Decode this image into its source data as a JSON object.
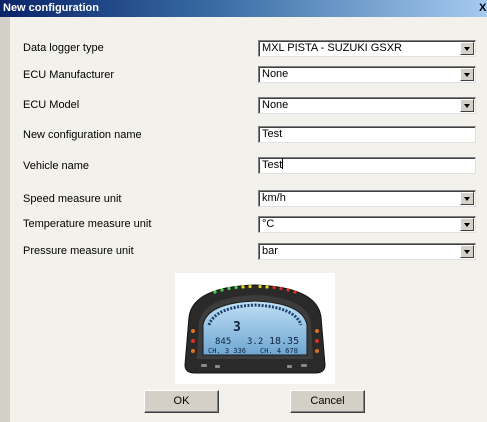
{
  "window": {
    "title": "New configuration",
    "close_label": "X"
  },
  "form": {
    "rows": [
      {
        "label": "Data logger type",
        "value": "MXL PISTA - SUZUKI GSXR",
        "control": "dropdown"
      },
      {
        "label": "ECU Manufacturer",
        "value": "None",
        "control": "dropdown"
      },
      {
        "label": "ECU Model",
        "value": "None",
        "control": "dropdown"
      },
      {
        "label": "New configuration name",
        "value": "Test",
        "control": "text"
      },
      {
        "label": "Vehicle name",
        "value": "Test",
        "control": "text"
      },
      {
        "label": "Speed measure unit",
        "value": "km/h",
        "control": "dropdown"
      },
      {
        "label": "Temperature measure unit",
        "value": "°C",
        "control": "dropdown"
      },
      {
        "label": "Pressure measure unit",
        "value": "bar",
        "control": "dropdown"
      }
    ]
  },
  "preview": {
    "display": {
      "gear": "3",
      "row1_left": "845",
      "row1_mid": "3.2",
      "row1_right": "18.35",
      "row2_left": "CH. 3 336",
      "row2_right": "CH. 4 678"
    }
  },
  "buttons": {
    "ok_label": "OK",
    "cancel_label": "Cancel"
  }
}
